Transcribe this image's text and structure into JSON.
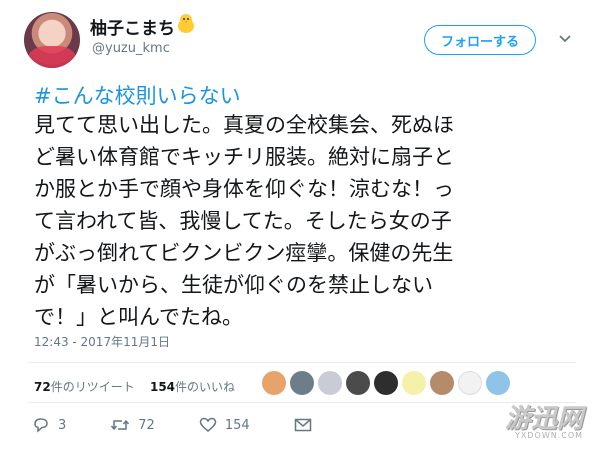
{
  "user": {
    "display_name": "柚子こまち",
    "handle": "@yuzu_kmc",
    "emoji_icon": "chick-emoji"
  },
  "follow_button": {
    "label": "フォローする"
  },
  "tweet": {
    "hashtag": "#こんな校則いらない",
    "text": "見てて思い出した。真夏の全校集会、死ぬほ\nど暑い体育館でキッチリ服装。絶対に扇子と\nか服とか手で顔や身体を仰ぐな！涼むな！っ\nて言われて皆、我慢してた。そしたら女の子\nがぶっ倒れてビクンビクン痙攣。保健の先生\nが「暑いから、生徒が仰ぐのを禁止しない\nで！」と叫んでたね。",
    "timestamp": "12:43 - 2017年11月1日"
  },
  "stats": {
    "retweets_count": "72",
    "retweets_label": "件のリツイート",
    "likes_count": "154",
    "likes_label": "件のいいね"
  },
  "actions": {
    "replies": "3",
    "retweets": "72",
    "likes": "154"
  },
  "watermark": {
    "text": "游迅网",
    "sub": "YXDOWN.COM"
  },
  "colors": {
    "accent": "#1da1f2",
    "hashtag": "#1b95e0",
    "muted": "#657786"
  }
}
